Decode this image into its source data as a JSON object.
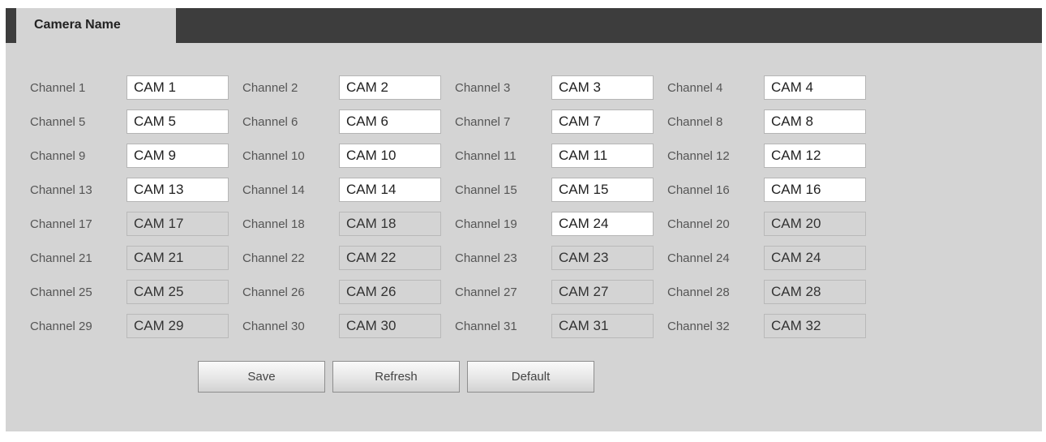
{
  "tab": {
    "title": "Camera Name"
  },
  "channels": [
    [
      {
        "label": "Channel 1",
        "value": "CAM 1",
        "enabled": true
      },
      {
        "label": "Channel 2",
        "value": "CAM 2",
        "enabled": true
      },
      {
        "label": "Channel 3",
        "value": "CAM 3",
        "enabled": true
      },
      {
        "label": "Channel 4",
        "value": "CAM 4",
        "enabled": true
      }
    ],
    [
      {
        "label": "Channel 5",
        "value": "CAM 5",
        "enabled": true
      },
      {
        "label": "Channel 6",
        "value": "CAM 6",
        "enabled": true
      },
      {
        "label": "Channel 7",
        "value": "CAM 7",
        "enabled": true
      },
      {
        "label": "Channel 8",
        "value": "CAM 8",
        "enabled": true
      }
    ],
    [
      {
        "label": "Channel 9",
        "value": "CAM 9",
        "enabled": true
      },
      {
        "label": "Channel 10",
        "value": "CAM 10",
        "enabled": true
      },
      {
        "label": "Channel 11",
        "value": "CAM 11",
        "enabled": true
      },
      {
        "label": "Channel 12",
        "value": "CAM 12",
        "enabled": true
      }
    ],
    [
      {
        "label": "Channel 13",
        "value": "CAM 13",
        "enabled": true
      },
      {
        "label": "Channel 14",
        "value": "CAM 14",
        "enabled": true
      },
      {
        "label": "Channel 15",
        "value": "CAM 15",
        "enabled": true
      },
      {
        "label": "Channel 16",
        "value": "CAM 16",
        "enabled": true
      }
    ],
    [
      {
        "label": "Channel 17",
        "value": "CAM 17",
        "enabled": false
      },
      {
        "label": "Channel 18",
        "value": "CAM 18",
        "enabled": false
      },
      {
        "label": "Channel 19",
        "value": "CAM 24",
        "enabled": true
      },
      {
        "label": "Channel 20",
        "value": "CAM 20",
        "enabled": false
      }
    ],
    [
      {
        "label": "Channel 21",
        "value": "CAM 21",
        "enabled": false
      },
      {
        "label": "Channel 22",
        "value": "CAM 22",
        "enabled": false
      },
      {
        "label": "Channel 23",
        "value": "CAM 23",
        "enabled": false
      },
      {
        "label": "Channel 24",
        "value": "CAM 24",
        "enabled": false
      }
    ],
    [
      {
        "label": "Channel 25",
        "value": "CAM 25",
        "enabled": false
      },
      {
        "label": "Channel 26",
        "value": "CAM 26",
        "enabled": false
      },
      {
        "label": "Channel 27",
        "value": "CAM 27",
        "enabled": false
      },
      {
        "label": "Channel 28",
        "value": "CAM 28",
        "enabled": false
      }
    ],
    [
      {
        "label": "Channel 29",
        "value": "CAM 29",
        "enabled": false
      },
      {
        "label": "Channel 30",
        "value": "CAM 30",
        "enabled": false
      },
      {
        "label": "Channel 31",
        "value": "CAM 31",
        "enabled": false
      },
      {
        "label": "Channel 32",
        "value": "CAM 32",
        "enabled": false
      }
    ]
  ],
  "buttons": {
    "save": "Save",
    "refresh": "Refresh",
    "default": "Default"
  },
  "colors": {
    "tab_bar": "#3d3d3d",
    "panel": "#d4d4d4",
    "input_enabled": "#ffffff",
    "input_disabled": "#d4d4d4"
  }
}
